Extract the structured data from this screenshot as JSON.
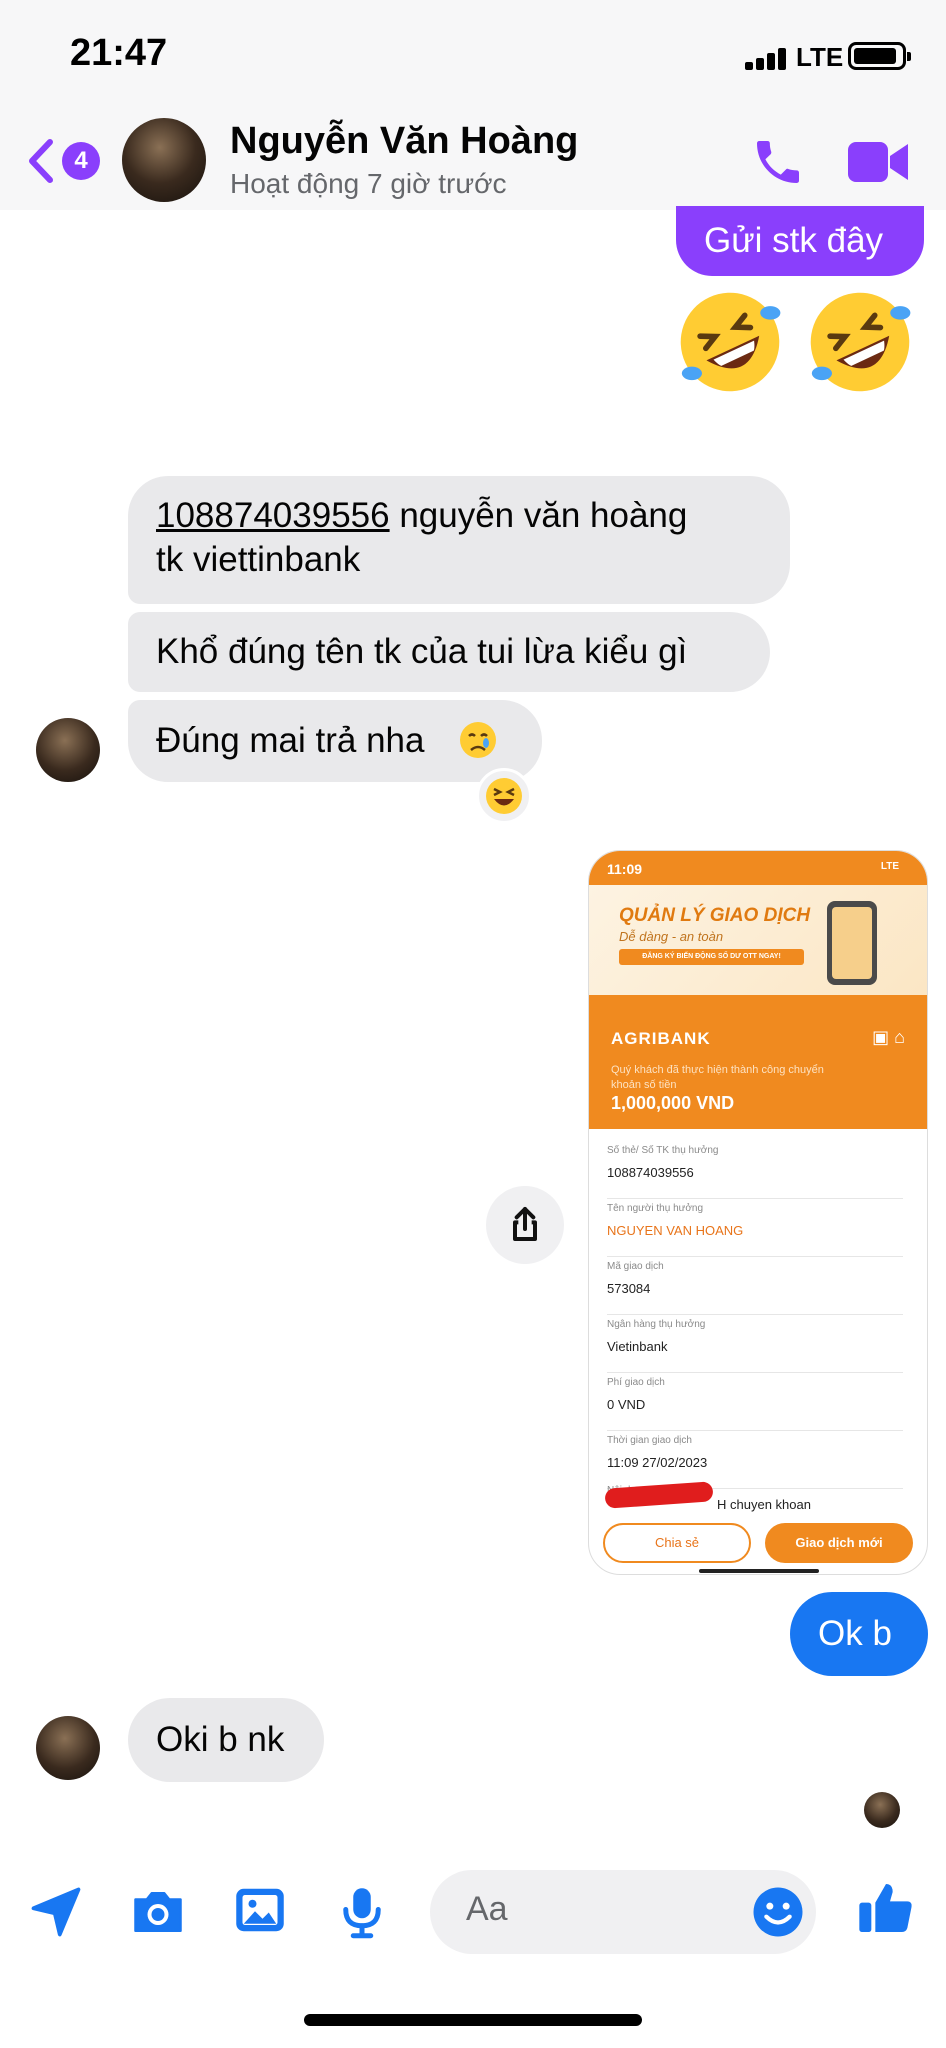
{
  "status_bar": {
    "time": "21:47",
    "network": "LTE"
  },
  "header": {
    "unread_count": "4",
    "contact_name": "Nguyễn Văn Hoàng",
    "contact_status": "Hoạt động 7 giờ trước"
  },
  "messages": {
    "m1_sent": "Gửi stk đây",
    "m2_account_number": "108874039556",
    "m2_rest_line1": " nguyễn văn hoàng",
    "m2_line2": "tk viettinbank",
    "m3": "Khổ đúng tên tk của tui lừa kiểu gì",
    "m4": "Đúng mai trả nha",
    "m5_sent": "Ok b",
    "m6": "Oki b nk"
  },
  "shared_image": {
    "time": "11:09",
    "network": "LTE",
    "banner_title": "QUẢN LÝ GIAO DỊCH",
    "banner_subtitle": "Dễ dàng - an toàn",
    "banner_button": "ĐĂNG KÝ BIẾN ĐỘNG SỐ DƯ OTT NGAY!",
    "bank_name": "AGRIBANK",
    "success_message": "Quý khách đã thực hiện thành công chuyển khoản số tiền",
    "amount": "1,000,000 VND",
    "details": [
      {
        "label": "Số thẻ/ Số TK thụ hưởng",
        "value": "108874039556"
      },
      {
        "label": "Tên người thụ hưởng",
        "value": "NGUYEN VAN HOANG"
      },
      {
        "label": "Mã giao dịch",
        "value": "573084"
      },
      {
        "label": "Ngân hàng thụ hưởng",
        "value": "Vietinbank"
      },
      {
        "label": "Phí giao dịch",
        "value": "0 VND"
      },
      {
        "label": "Thời gian giao dịch",
        "value": "11:09 27/02/2023"
      },
      {
        "label": "Nội dung CK",
        "value": "H chuyen khoan"
      }
    ],
    "share_button": "Chia sẻ",
    "new_transaction_button": "Giao dịch mới"
  },
  "composer": {
    "placeholder": "Aa"
  },
  "colors": {
    "messenger_purple": "#8a3ffc",
    "messenger_blue": "#1877f2",
    "received_bubble": "#e9e9eb",
    "agribank_orange": "#f08a1f"
  },
  "icons": [
    "back-chevron-icon",
    "phone-icon",
    "video-camera-icon",
    "share-icon",
    "location-arrow-icon",
    "camera-icon",
    "gallery-icon",
    "microphone-icon",
    "smiley-icon",
    "thumbs-up-icon"
  ]
}
